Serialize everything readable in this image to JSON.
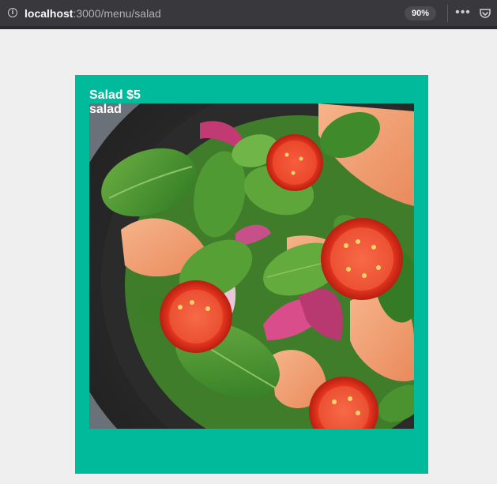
{
  "browser": {
    "url_host": "localhost",
    "url_path": ":3000/menu/salad",
    "zoom_level": "90%",
    "info_icon": "info-icon",
    "more_icon": "more-icon",
    "pocket_icon": "pocket-icon"
  },
  "menu_item": {
    "title": "Salad $5",
    "category": "salad",
    "image_subject": "salad-bowl-photo"
  },
  "colors": {
    "card_background": "#00bb9b",
    "page_background": "#efefef",
    "toolbar_background": "#38383d"
  }
}
